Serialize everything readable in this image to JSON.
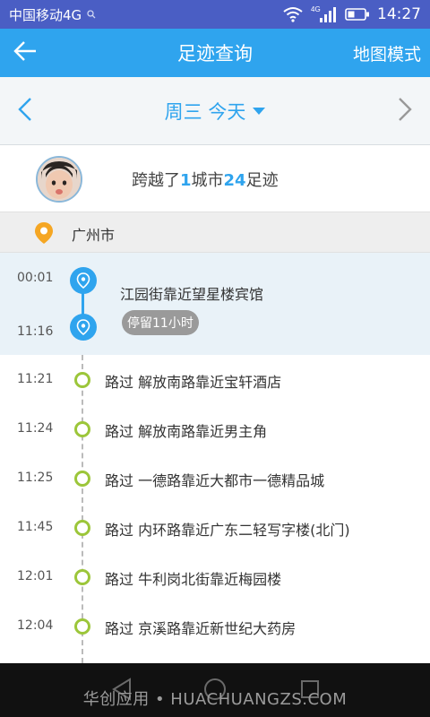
{
  "status_bar": {
    "carrier": "中国移动4G",
    "network": "4G",
    "time": "14:27"
  },
  "title_bar": {
    "title": "足迹查询",
    "map_mode": "地图模式"
  },
  "date_bar": {
    "date_label": "周三 今天"
  },
  "summary": {
    "prefix": "跨越了",
    "cities": "1",
    "middle": "城市",
    "footprints": "24",
    "suffix": "足迹"
  },
  "city": "广州市",
  "stay": {
    "start_time": "00:01",
    "end_time": "11:16",
    "place": "江园街靠近望星楼宾馆",
    "duration": "停留11小时"
  },
  "passes": [
    {
      "time": "11:21",
      "label": "路过 解放南路靠近宝轩酒店"
    },
    {
      "time": "11:24",
      "label": "路过 解放南路靠近男主角"
    },
    {
      "time": "11:25",
      "label": "路过 一德路靠近大都市一德精品城"
    },
    {
      "time": "11:45",
      "label": "路过 内环路靠近广东二轻写字楼(北门)"
    },
    {
      "time": "12:01",
      "label": "路过 牛利岗北街靠近梅园楼"
    },
    {
      "time": "12:04",
      "label": "路过 京溪路靠近新世纪大药房"
    }
  ],
  "watermark": "华创应用 • HUACHUANGZS.COM",
  "colors": {
    "status_bar": "#4a5ec4",
    "title_bar": "#2fa4ee",
    "accent": "#2fa4ee",
    "pass_ring": "#9cc63a",
    "city_pin": "#f5a623"
  },
  "icons": {
    "back": "arrow-left-icon",
    "prev_day": "chevron-left-icon",
    "next_day": "chevron-right-icon",
    "dropdown": "caret-down-icon",
    "city": "map-pin-icon",
    "stay_marker": "location-pin-icon",
    "pass_marker": "ring-dot-icon"
  }
}
